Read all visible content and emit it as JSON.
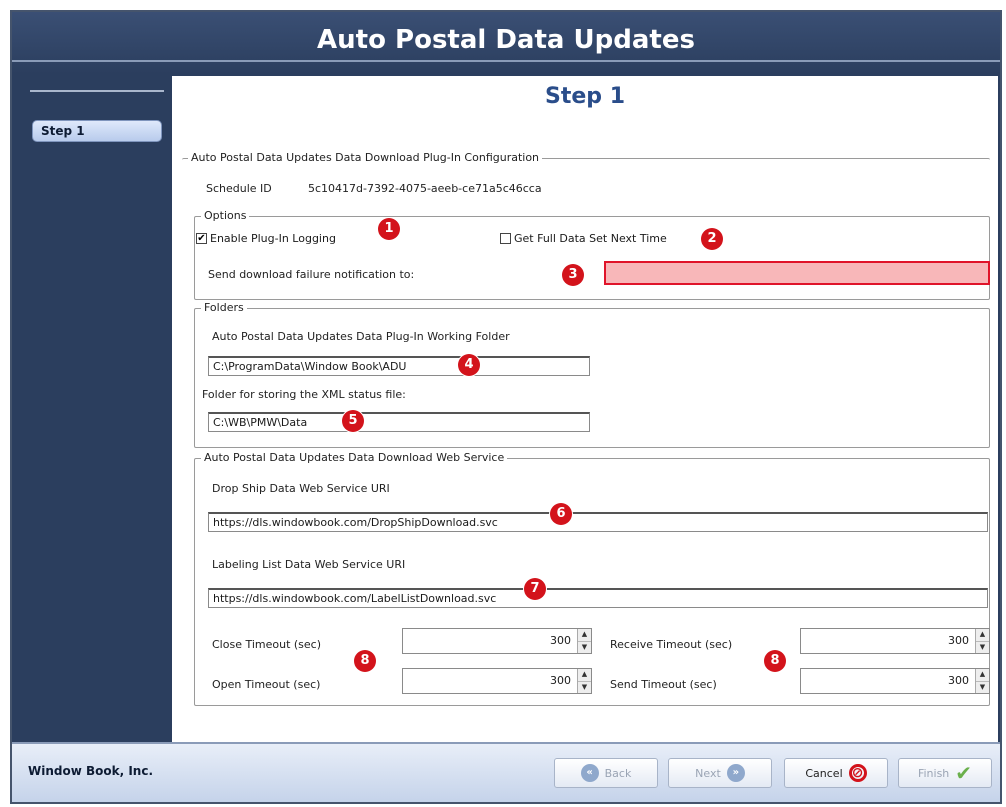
{
  "window": {
    "title": "Auto Postal Data Updates"
  },
  "sidebar": {
    "items": [
      {
        "label": "Step 1"
      }
    ]
  },
  "main": {
    "title": "Step 1"
  },
  "config_group": {
    "legend": "Auto Postal Data Updates Data Download Plug-In Configuration",
    "schedule_label": "Schedule ID",
    "schedule_value": "5c10417d-7392-4075-aeeb-ce71a5c46cca"
  },
  "options": {
    "legend": "Options",
    "enable_logging": {
      "label": "Enable Plug-In Logging",
      "checked": true,
      "mark": "✔"
    },
    "full_data_set": {
      "label": "Get Full Data Set Next Time",
      "checked": false,
      "mark": ""
    },
    "notification_label": "Send download failure notification to:",
    "notification_value": ""
  },
  "folders": {
    "legend": "Folders",
    "working_label": "Auto Postal Data Updates Data Plug-In Working Folder",
    "working_value": "C:\\ProgramData\\Window Book\\ADU",
    "xml_label": "Folder for storing the XML status file:",
    "xml_value": "C:\\WB\\PMW\\Data"
  },
  "web_service": {
    "legend": "Auto Postal Data Updates Data Download Web Service",
    "drop_ship_label": "Drop Ship Data Web Service URI",
    "drop_ship_value": "https://dls.windowbook.com/DropShipDownload.svc",
    "labeling_label": "Labeling List Data Web Service URI",
    "labeling_value": "https://dls.windowbook.com/LabelListDownload.svc",
    "close_timeout": {
      "label": "Close Timeout (sec)",
      "value": "300"
    },
    "open_timeout": {
      "label": "Open Timeout (sec)",
      "value": "300"
    },
    "receive_timeout": {
      "label": "Receive Timeout (sec)",
      "value": "300"
    },
    "send_timeout": {
      "label": "Send Timeout (sec)",
      "value": "300"
    }
  },
  "markers": [
    "1",
    "2",
    "3",
    "4",
    "5",
    "6",
    "7",
    "8",
    "8"
  ],
  "footer": {
    "company": "Window Book, Inc.",
    "back": {
      "label": "Back",
      "icon": "back-arrow-icon"
    },
    "next": {
      "label": "Next",
      "icon": "next-arrow-icon"
    },
    "cancel": {
      "label": "Cancel",
      "icon": "cancel-icon"
    },
    "finish": {
      "label": "Finish",
      "icon": "checkmark-icon"
    }
  },
  "colors": {
    "frame": "#2b3e5e",
    "accent_title": "#2a4d8a",
    "marker": "#d3131b",
    "error_field_bg": "#f8b7b9",
    "error_field_border": "#e0142a"
  }
}
